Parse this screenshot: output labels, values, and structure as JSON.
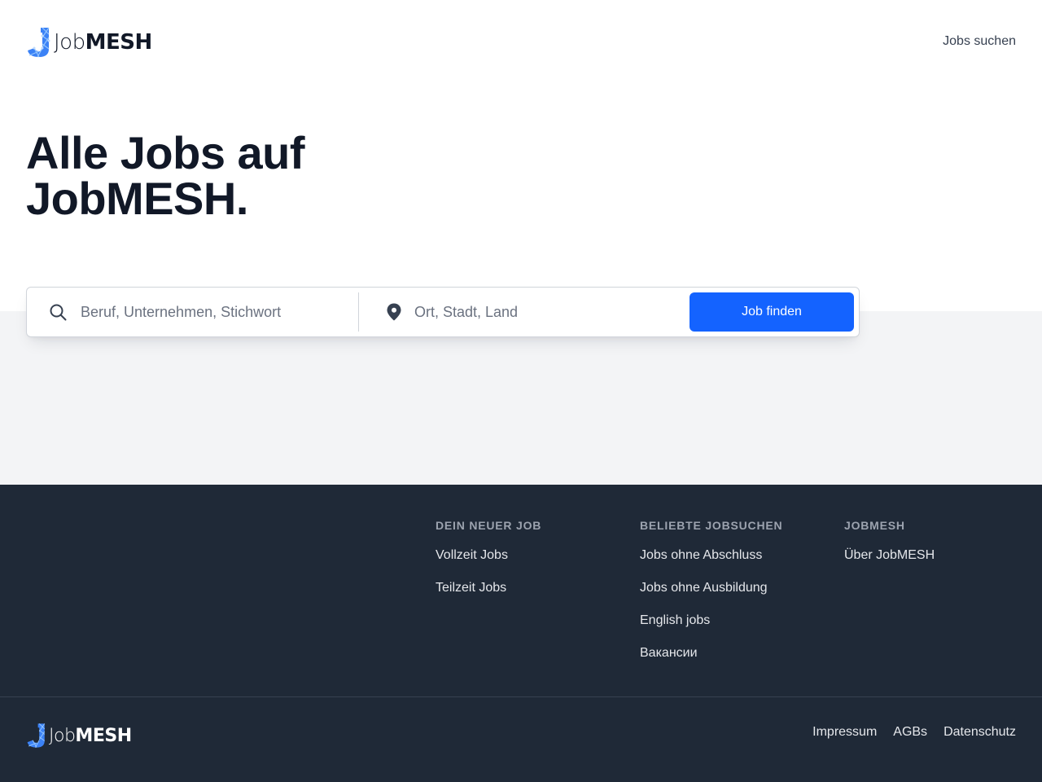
{
  "brand": {
    "name_light": "Job",
    "name_bold": "MESH",
    "accent": "#1463ff"
  },
  "header": {
    "nav_link": "Jobs suchen"
  },
  "hero": {
    "title_line1": "Alle Jobs auf",
    "title_line2": "JobMESH."
  },
  "search": {
    "what_placeholder": "Beruf, Unternehmen, Stichwort",
    "where_placeholder": "Ort, Stadt, Land",
    "button_label": "Job finden",
    "what_icon": "search-icon",
    "where_icon": "map-pin-icon"
  },
  "footer": {
    "columns": [
      {
        "heading": "DEIN NEUER JOB",
        "links": [
          "Vollzeit Jobs",
          "Teilzeit Jobs"
        ]
      },
      {
        "heading": "BELIEBTE JOBSUCHEN",
        "links": [
          "Jobs ohne Abschluss",
          "Jobs ohne Ausbildung",
          "English jobs",
          "Вакансии"
        ]
      },
      {
        "heading": "JOBMESH",
        "links": [
          "Über JobMESH"
        ]
      }
    ],
    "legal": [
      "Impressum",
      "AGBs",
      "Datenschutz"
    ]
  },
  "colors": {
    "footer_bg": "#1f2937",
    "band_bg": "#f3f4f6",
    "text_dark": "#111827"
  }
}
